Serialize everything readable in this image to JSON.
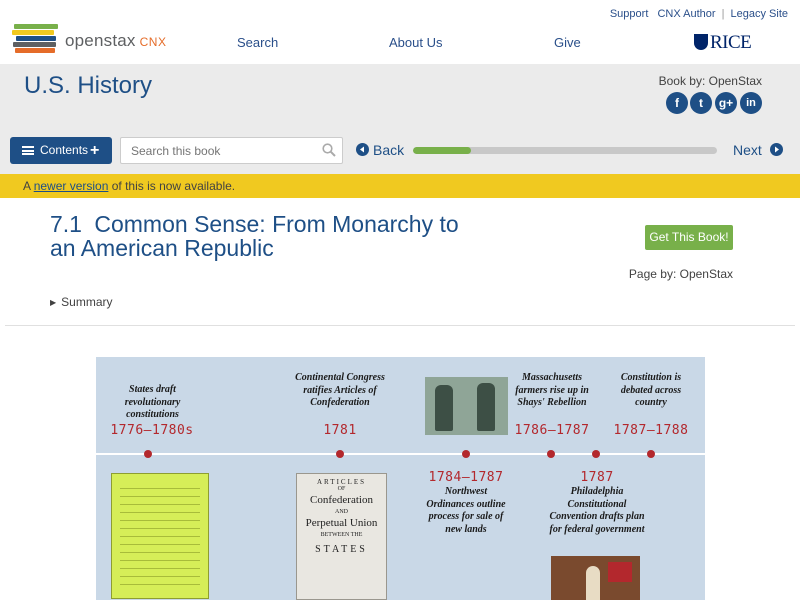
{
  "header": {
    "logo_text": "openstax",
    "logo_suffix": "CNX",
    "util_links": [
      "Support",
      "CNX Author",
      "Legacy Site"
    ],
    "nav": [
      "Search",
      "About Us",
      "Give"
    ],
    "partner_logo": "RICE",
    "colors": {
      "brand_blue": "#1e4f86",
      "accent_green": "#78b04a",
      "notice_yellow": "#f0c920",
      "logo_orange": "#e56c29"
    }
  },
  "book": {
    "title": "U.S. History",
    "book_by": "Book by: OpenStax",
    "social_icons": [
      "facebook-icon",
      "twitter-icon",
      "google-plus-icon",
      "linkedin-icon"
    ]
  },
  "toolbar": {
    "contents_label": "Contents",
    "search_placeholder": "Search this book",
    "back_label": "Back",
    "next_label": "Next",
    "progress": 0.19
  },
  "notice": {
    "prefix": "A ",
    "link": "newer version",
    "suffix": " of this is now available."
  },
  "section": {
    "number": "7.1",
    "title": "Common Sense: From Monarchy to an American Republic",
    "get_book_label": "Get This Book!",
    "page_by": "Page by: OpenStax",
    "summary_label": "Summary"
  },
  "timeline": {
    "events": [
      {
        "desc": "States draft revolutionary constitutions",
        "year": "1776–1780s"
      },
      {
        "desc": "Continental Congress ratifies Articles of Confederation",
        "year": "1781"
      },
      {
        "year": "1784–1787",
        "desc": "Northwest Ordinances outline process for sale of new lands"
      },
      {
        "desc": "Massachusetts farmers rise up in Shays' Rebellion",
        "year": "1786–1787"
      },
      {
        "year": "1787",
        "desc": "Philadelphia Constitutional Convention drafts plan for federal government"
      },
      {
        "desc": "Constitution is debated across country",
        "year": "1787–1788"
      }
    ],
    "articles_image_text": [
      "ARTICLES",
      "OF",
      "Confederation",
      "AND",
      "Perpetual Union",
      "BETWEEN THE",
      "STATES"
    ]
  }
}
